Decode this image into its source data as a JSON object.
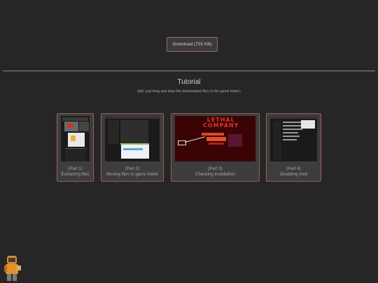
{
  "download": {
    "label": "Download (725 KB)"
  },
  "tutorial": {
    "title": "Tutorial",
    "subtitle": "(tldr: just drag and drop the downloaded files to the game folder)"
  },
  "cards": [
    {
      "part": "(Part 1)",
      "label": "Extracting files"
    },
    {
      "part": "(Part 2)",
      "label": "Moving files to game folder"
    },
    {
      "part": "(Part 3)",
      "label": "Checking installation"
    },
    {
      "part": "(Part 4)",
      "label": "Disabling mod"
    }
  ],
  "thumb3": {
    "logo_line1": "LETHAL",
    "logo_line2": "COMPANY"
  },
  "colors": {
    "accent_border": "#9a6058",
    "background": "#262626",
    "card": "#3d3d3d"
  }
}
